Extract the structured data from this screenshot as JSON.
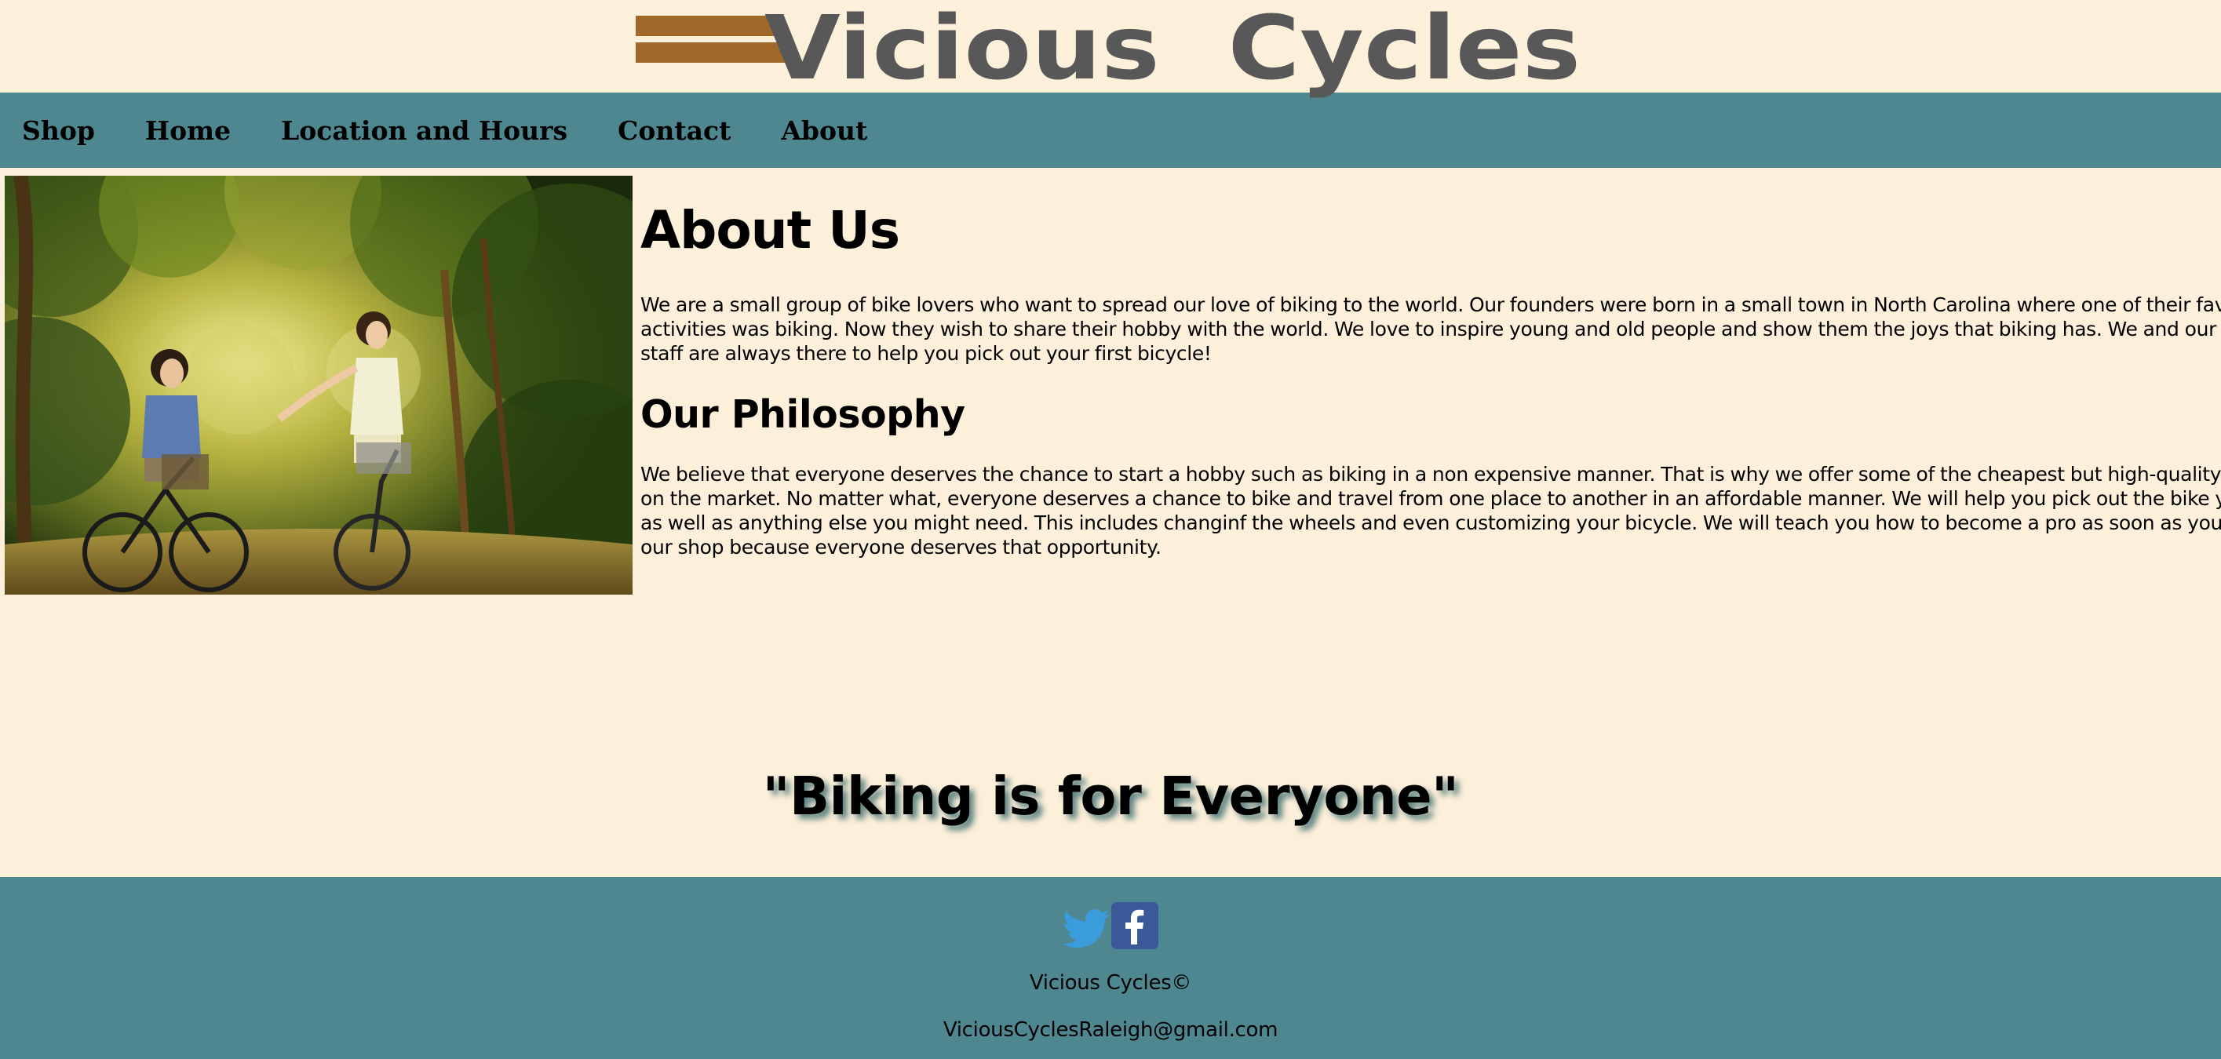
{
  "logo": {
    "text": "Vicious  Cycles",
    "text_color": "#585858",
    "stripe_color": "#a0692a"
  },
  "nav": {
    "items": [
      "Shop",
      "Home",
      "Location and Hours",
      "Contact",
      "About"
    ]
  },
  "hero_image": {
    "description": "two-women-riding-bicycles-on-forest-path"
  },
  "about": {
    "heading": "About Us",
    "paragraph_lines": [
      "We are a small group of bike lovers who want to spread our love of biking to the world. Our founders were born in a small town in North Carolina where one of their favorite",
      "activities was biking. Now they wish to share their hobby with the world. We love to inspire young and old people and show them the joys that biking has. We and our loving",
      "staff are always there to help you pick out your first bicycle!"
    ]
  },
  "philosophy": {
    "heading": "Our Philosophy",
    "paragraph_lines": [
      "We believe that everyone deserves the chance to start a hobby such as biking in a non expensive manner. That is why we offer some of the cheapest but high-quality bicycles",
      "on the market. No matter what, everyone deserves a chance to bike and travel from one place to another in an affordable manner. We will help you pick out the bike you want",
      "as well as anything else you might need. This includes changinf the wheels and even customizing your bicycle. We will teach you how to become a pro as soon as you walk into",
      "our shop because everyone deserves that opportunity."
    ]
  },
  "tagline": "\"Biking is for Everyone\"",
  "footer": {
    "social": [
      {
        "name": "twitter",
        "icon": "twitter-bird-icon",
        "color": "#3b9cdc"
      },
      {
        "name": "facebook",
        "icon": "facebook-f-icon",
        "color": "#3b5998"
      }
    ],
    "brand": "Vicious Cycles©",
    "email": "ViciousCyclesRaleigh@gmail.com"
  },
  "colors": {
    "page_background": "#fdf0da",
    "nav_footer_background": "#4e8790"
  }
}
